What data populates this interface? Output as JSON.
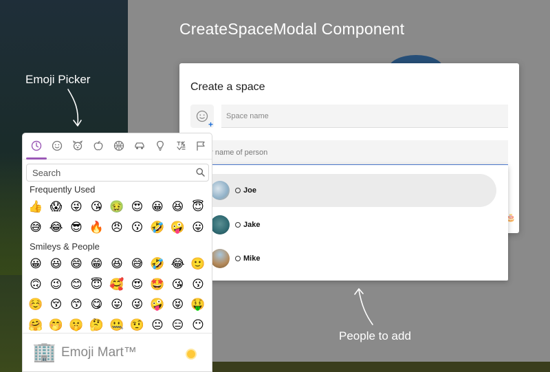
{
  "page": {
    "title": "CreateSpaceModal Component"
  },
  "annotations": {
    "emoji_picker": "Emoji Picker",
    "people": "People to add"
  },
  "modal": {
    "title": "Create a space",
    "space_name_placeholder": "Space name",
    "person_placeholder": "er name of person",
    "right_text": "sts 🎂"
  },
  "people": [
    {
      "name": "Joe",
      "highlighted": true,
      "avatar_color": "#8fb0c7"
    },
    {
      "name": "Jake",
      "highlighted": false,
      "avatar_color": "#2f6a72"
    },
    {
      "name": "Mike",
      "highlighted": false,
      "avatar_color": "#b48a5b"
    }
  ],
  "picker": {
    "categories": [
      "recent-icon",
      "smiley-icon",
      "animal-icon",
      "food-icon",
      "activity-icon",
      "travel-icon",
      "objects-icon",
      "symbols-icon",
      "flags-icon"
    ],
    "search_placeholder": "Search",
    "frequently_used_label": "Frequently Used",
    "smileys_label": "Smileys & People",
    "frequently_used": [
      "👍",
      "😱",
      "😜",
      "😘",
      "🤢",
      "😍",
      "😀",
      "😆",
      "😇",
      "😅",
      "😂",
      "😎",
      "🔥",
      "😠",
      "😗",
      "🤣",
      "🤪",
      "😛"
    ],
    "smileys": [
      "😀",
      "😃",
      "😄",
      "😁",
      "😆",
      "😅",
      "🤣",
      "😂",
      "🙂",
      "🙃",
      "😉",
      "😊",
      "😇",
      "🥰",
      "😍",
      "🤩",
      "😘",
      "😗",
      "☺️",
      "😚",
      "😙",
      "😋",
      "😛",
      "😜",
      "🤪",
      "😝",
      "🤑",
      "🤗",
      "🤭",
      "🤫",
      "🤔",
      "🤐",
      "🤨",
      "😐",
      "😑",
      "😶"
    ],
    "footer_icon": "🏢",
    "footer_name": "Emoji Mart™",
    "accent_color": "#9b59b6"
  }
}
